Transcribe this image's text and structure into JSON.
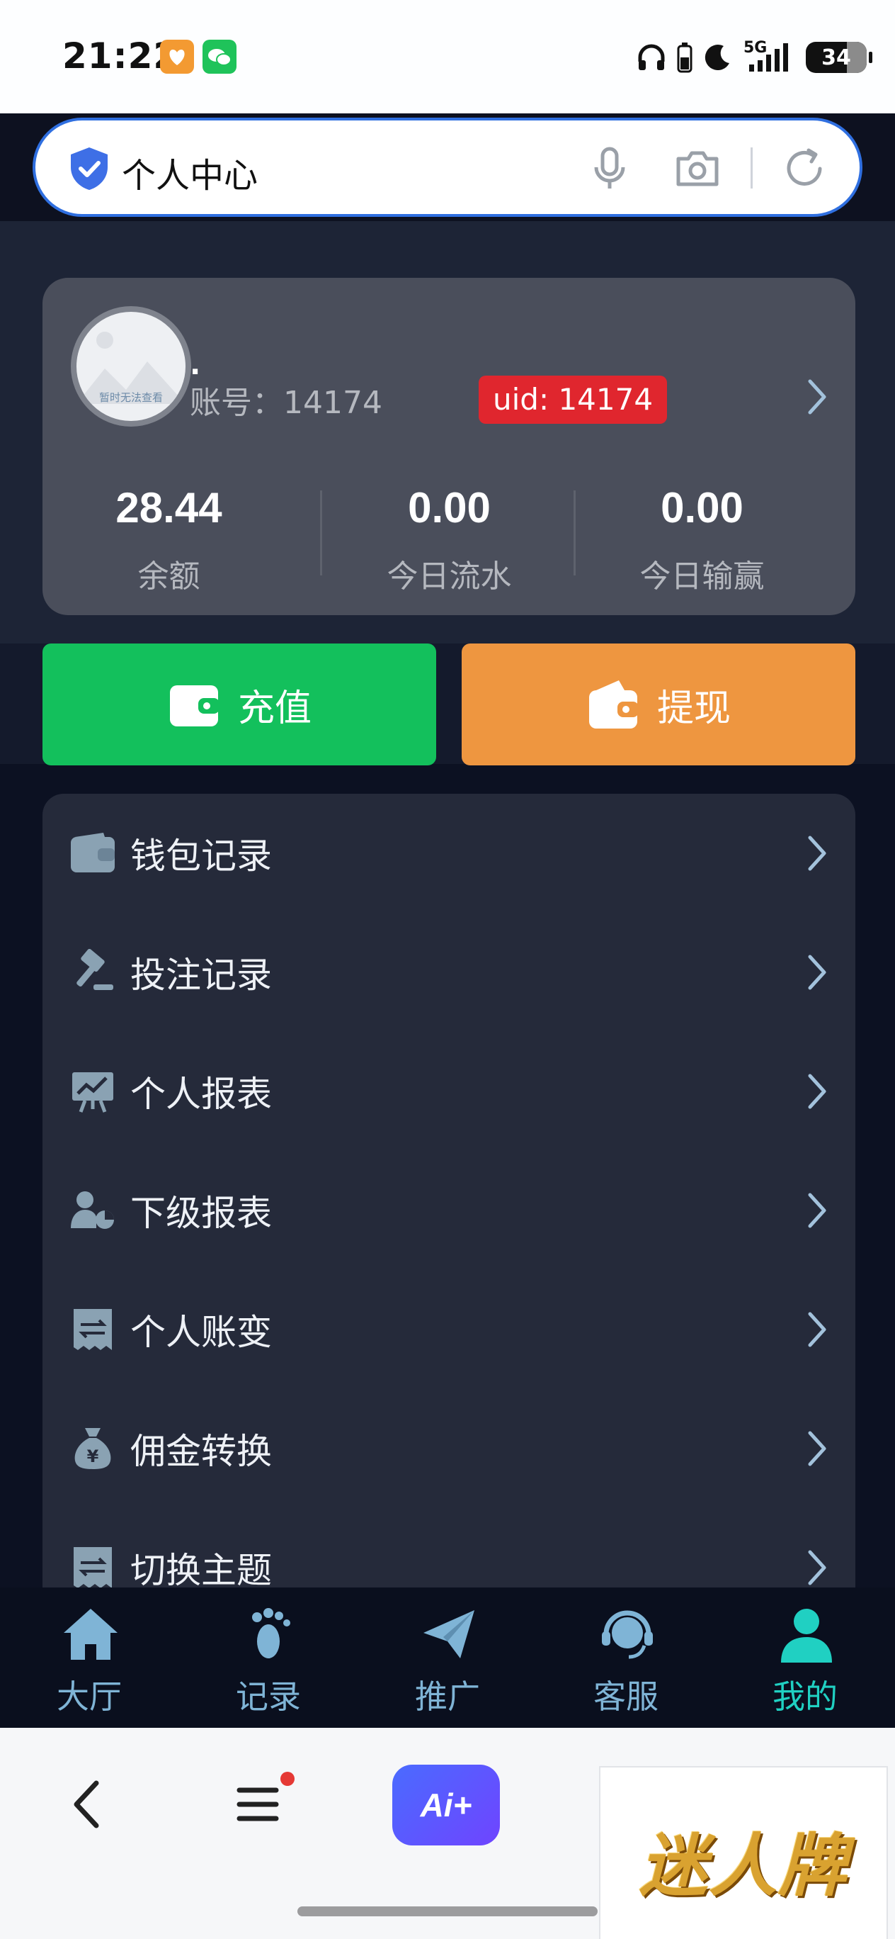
{
  "status_bar": {
    "time": "21:22",
    "network": "5G",
    "battery": "34"
  },
  "search": {
    "title": "个人中心"
  },
  "profile": {
    "nickname": ".",
    "avatar_text": "暂时无法查看",
    "account": "账号：14174",
    "uid": "uid: 14174",
    "stats": [
      {
        "value": "28.44",
        "label": "余额"
      },
      {
        "value": "0.00",
        "label": "今日流水"
      },
      {
        "value": "0.00",
        "label": "今日输赢"
      }
    ]
  },
  "actions": {
    "recharge": "充值",
    "withdraw": "提现"
  },
  "menu": [
    {
      "label": "钱包记录",
      "icon": "wallet-icon"
    },
    {
      "label": "投注记录",
      "icon": "gavel-icon"
    },
    {
      "label": "个人报表",
      "icon": "chart-board-icon"
    },
    {
      "label": "下级报表",
      "icon": "user-pie-icon"
    },
    {
      "label": "个人账变",
      "icon": "receipt-icon"
    },
    {
      "label": "佣金转换",
      "icon": "money-bag-icon"
    },
    {
      "label": "切换主题",
      "icon": "switch-theme-icon"
    }
  ],
  "tabs": [
    {
      "label": "大厅",
      "icon": "home-icon"
    },
    {
      "label": "记录",
      "icon": "footprint-icon"
    },
    {
      "label": "推广",
      "icon": "paper-plane-icon"
    },
    {
      "label": "客服",
      "icon": "headset-icon"
    },
    {
      "label": "我的",
      "icon": "user-icon",
      "active": true
    }
  ],
  "browser": {
    "ai_label": "Ai+",
    "brand": "迷人牌"
  },
  "colors": {
    "accent": "#20d0c2",
    "recharge": "#13c05c",
    "withdraw": "#ee9640",
    "uid_badge": "#e0262e"
  }
}
